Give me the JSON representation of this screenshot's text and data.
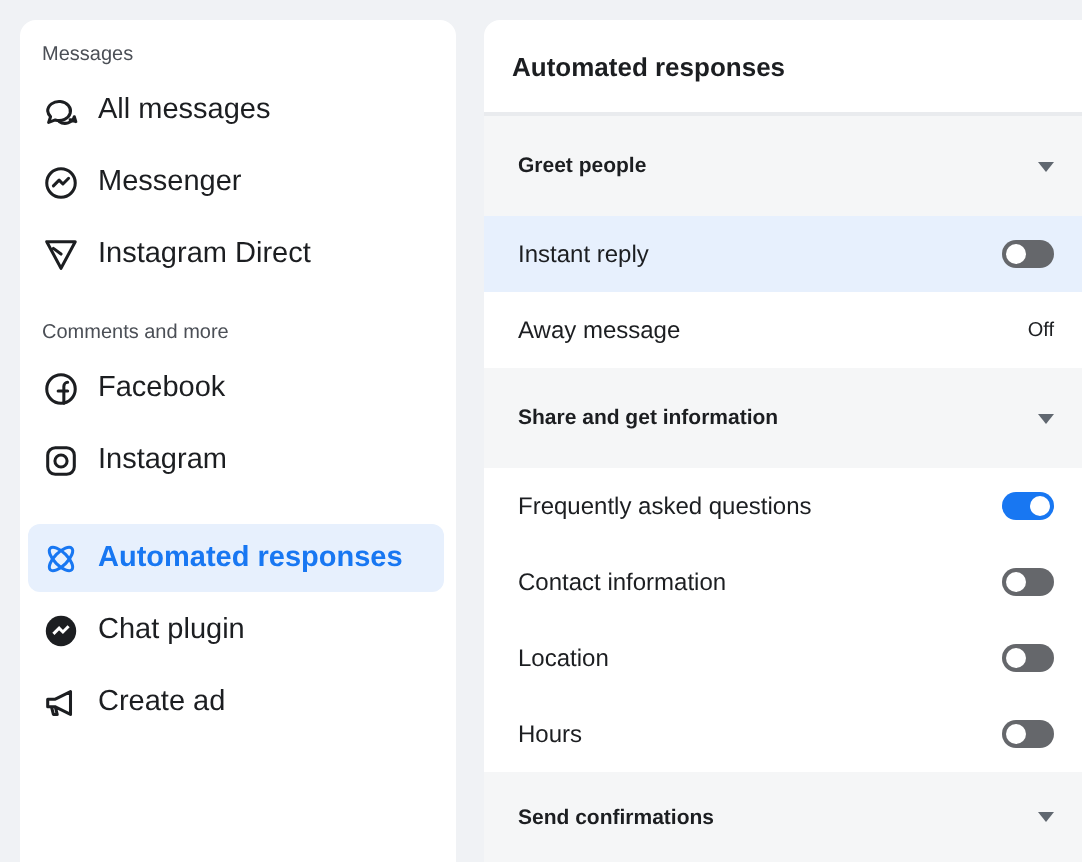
{
  "sidebar": {
    "sections": [
      {
        "label": "Messages",
        "items": [
          {
            "label": "All messages",
            "selected": false
          },
          {
            "label": "Messenger",
            "selected": false
          },
          {
            "label": "Instagram Direct",
            "selected": false
          }
        ]
      },
      {
        "label": "Comments and more",
        "items": [
          {
            "label": "Facebook",
            "selected": false
          },
          {
            "label": "Instagram",
            "selected": false
          }
        ]
      },
      {
        "items": [
          {
            "label": "Automated responses",
            "selected": true
          },
          {
            "label": "Chat plugin",
            "selected": false
          },
          {
            "label": "Create ad",
            "selected": false
          }
        ]
      }
    ]
  },
  "panel": {
    "title": "Automated responses",
    "groups": [
      {
        "title": "Greet people",
        "rows": [
          {
            "label": "Instant reply",
            "kind": "toggle",
            "on": false,
            "selected": true
          },
          {
            "label": "Away message",
            "kind": "value",
            "value": "Off",
            "selected": false
          }
        ]
      },
      {
        "title": "Share and get information",
        "rows": [
          {
            "label": "Frequently asked questions",
            "kind": "toggle",
            "on": true,
            "selected": false
          },
          {
            "label": "Contact information",
            "kind": "toggle",
            "on": false,
            "selected": false
          },
          {
            "label": "Location",
            "kind": "toggle",
            "on": false,
            "selected": false
          },
          {
            "label": "Hours",
            "kind": "toggle",
            "on": false,
            "selected": false
          }
        ]
      },
      {
        "title": "Send confirmations"
      }
    ]
  }
}
